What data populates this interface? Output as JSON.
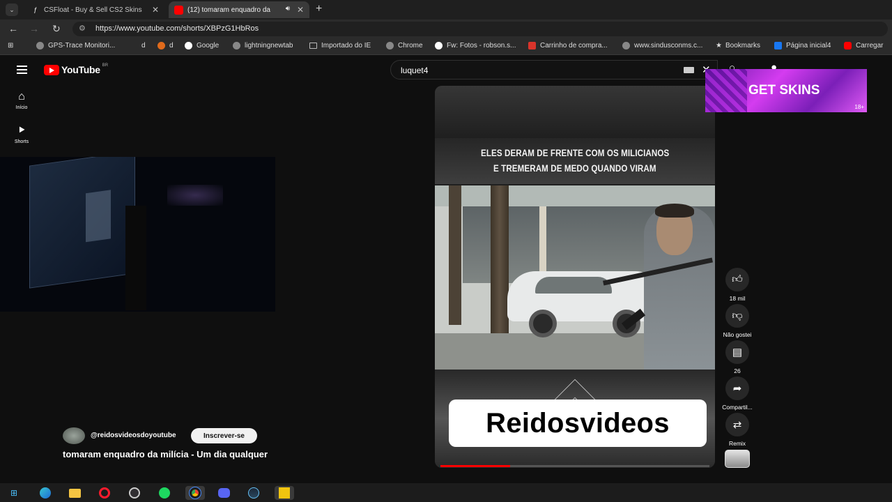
{
  "browser": {
    "tabs": [
      {
        "title": "CSFloat - Buy & Sell CS2 Skins",
        "favicon": "csfloat-icon"
      },
      {
        "title": "(12) tomaram enquadro da",
        "favicon": "youtube-icon"
      }
    ],
    "url": "https://www.youtube.com/shorts/XBPzG1HbRos",
    "bookmarks": [
      {
        "label": "GPS-Trace Monitori...",
        "icon": "globe-icon"
      },
      {
        "label": "d",
        "icon": "blank-icon"
      },
      {
        "label": "d",
        "icon": "fox-icon"
      },
      {
        "label": "Google",
        "icon": "google-icon"
      },
      {
        "label": "lightningnewtab",
        "icon": "globe-icon"
      },
      {
        "label": "Importado do IE",
        "icon": "folder-icon"
      },
      {
        "label": "Chrome",
        "icon": "globe-icon"
      },
      {
        "label": "Fw: Fotos - robson.s...",
        "icon": "google-icon"
      },
      {
        "label": "Carrinho de compra...",
        "icon": "shop-icon"
      },
      {
        "label": "www.sindusconms.c...",
        "icon": "globe-icon"
      },
      {
        "label": "Bookmarks",
        "icon": "star-icon"
      },
      {
        "label": "Página inicial4",
        "icon": "facebook-icon"
      },
      {
        "label": "Carregar",
        "icon": "youtube-icon"
      }
    ]
  },
  "youtube": {
    "logo": "YouTube",
    "country": "BR",
    "sidebar": [
      {
        "label": "Início",
        "icon": "home-icon"
      },
      {
        "label": "Shorts",
        "icon": "shorts-icon"
      }
    ],
    "search_value": "luquet4",
    "short": {
      "caption_line1": "ELES DERAM DE FRENTE COM OS MILICIANOS",
      "caption_line2": "E TREMERAM DE MEDO QUANDO VIRAM",
      "watermark": "Reidosvideos",
      "progress": 0.26
    },
    "actions": {
      "like_count": "18 mil",
      "dislike_label": "Não gostei",
      "comments_count": "26",
      "share_label": "Compartil...",
      "remix_label": "Remix"
    },
    "channel": {
      "handle": "@reidosvideosdoyoutube",
      "subscribe_label": "Inscrever-se"
    },
    "video_title": "tomaram enquadro da milícia - Um dia qualquer",
    "ad": {
      "text": "GET SKINS",
      "age": "18+"
    }
  },
  "taskbar": {
    "apps": [
      "windows-icon",
      "edge-icon",
      "file-explorer-icon",
      "opera-icon",
      "obs-icon",
      "spotify-icon",
      "chrome-icon",
      "discord-icon",
      "steam-icon",
      "kick-icon"
    ]
  },
  "colors": {
    "accent": "#ff0000",
    "background": "#0f0f0f",
    "ad": "#c83be8"
  }
}
